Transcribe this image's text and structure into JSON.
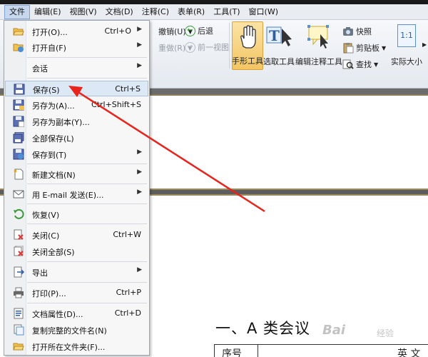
{
  "menubar": {
    "items": [
      "文件",
      "编辑(E)",
      "视图(V)",
      "文档(D)",
      "注释(C)",
      "表单(R)",
      "工具(T)",
      "窗口(W)"
    ]
  },
  "ribbon": {
    "undo": "撤销(U)",
    "redo": "重做(R)",
    "back": "后退",
    "forward": "前一视图",
    "hand_tool": "手形工具",
    "select_tool": "选取工具",
    "annotation_tool": "编辑注释工具",
    "snapshot": "快照",
    "clipboard": "剪贴板",
    "find": "查找",
    "actual_size": "实际大小",
    "actual_size_icon": "1:1"
  },
  "file_menu": {
    "items": [
      {
        "label": "打开(O)...",
        "shortcut": "Ctrl+O",
        "submenu": true,
        "icon": "folder-open-icon"
      },
      {
        "label": "打开自(F)",
        "shortcut": "",
        "submenu": true,
        "icon": "open-from-icon"
      },
      {
        "label": "会话",
        "shortcut": "",
        "submenu": true,
        "icon": ""
      },
      {
        "label": "保存(S)",
        "shortcut": "Ctrl+S",
        "submenu": false,
        "icon": "save-icon"
      },
      {
        "label": "另存为(A)...",
        "shortcut": "Ctrl+Shift+S",
        "submenu": false,
        "icon": "save-as-icon"
      },
      {
        "label": "另存为副本(Y)...",
        "shortcut": "",
        "submenu": false,
        "icon": "save-copy-icon"
      },
      {
        "label": "全部保存(L)",
        "shortcut": "",
        "submenu": false,
        "icon": "save-all-icon"
      },
      {
        "label": "保存到(T)",
        "shortcut": "",
        "submenu": true,
        "icon": "save-to-icon"
      },
      {
        "label": "新建文档(N)",
        "shortcut": "",
        "submenu": true,
        "icon": "new-document-icon"
      },
      {
        "label": "用 E-mail 发送(E)...",
        "shortcut": "",
        "submenu": true,
        "icon": "email-icon"
      },
      {
        "label": "恢复(V)",
        "shortcut": "",
        "submenu": false,
        "icon": "revert-icon"
      },
      {
        "label": "关闭(C)",
        "shortcut": "Ctrl+W",
        "submenu": false,
        "icon": "close-doc-icon"
      },
      {
        "label": "关闭全部(S)",
        "shortcut": "",
        "submenu": false,
        "icon": "close-all-icon"
      },
      {
        "label": "导出",
        "shortcut": "",
        "submenu": true,
        "icon": "export-icon"
      },
      {
        "label": "打印(P)...",
        "shortcut": "Ctrl+P",
        "submenu": false,
        "icon": "print-icon"
      },
      {
        "label": "文档属性(D)...",
        "shortcut": "Ctrl+D",
        "submenu": false,
        "icon": "properties-icon"
      },
      {
        "label": "复制完整的文件名(N)",
        "shortcut": "",
        "submenu": false,
        "icon": "copy-filename-icon"
      },
      {
        "label": "打开所在文件夹(F)...",
        "shortcut": "",
        "submenu": false,
        "icon": "open-folder-icon"
      }
    ]
  },
  "document": {
    "heading": "一、A 类会议",
    "table_col1": "序号",
    "table_col2": "英 文"
  },
  "watermark": {
    "text": "Bai",
    "sub": "经验"
  },
  "colors": {
    "arrow": "#e8241c",
    "accent": "#7ea3d4"
  }
}
